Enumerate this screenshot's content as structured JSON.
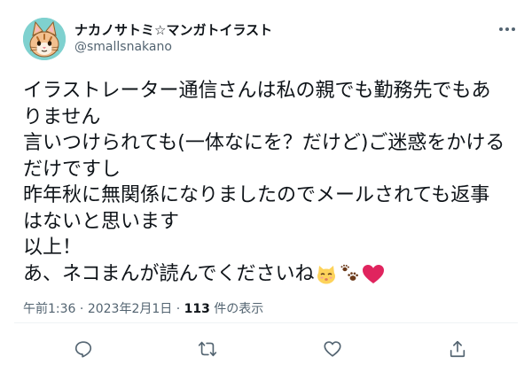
{
  "author": {
    "display_name": "ナカノサトミ☆マンガトイラスト",
    "handle": "@smallsnakano",
    "avatar_icon": "cat-avatar-icon"
  },
  "tweet": {
    "lines": [
      "イラストレーター通信さんは私の親でも勤務先でもあ",
      "りません",
      "言いつけられても(一体なにを？だけど)ご迷惑をかける",
      "だけですし",
      "昨年秋に無関係になりましたのでメールされても返事",
      "はないと思います",
      "以上！",
      "あ、ネコまんが読んでくださいね"
    ],
    "emojis": [
      "kissing-cat-emoji",
      "paw-prints-emoji",
      "red-heart-emoji"
    ]
  },
  "meta": {
    "time": "午前1:36",
    "separator": " · ",
    "date": "2023年2月1日",
    "views_count": "113",
    "views_label": " 件の表示"
  },
  "actions": [
    "reply-icon",
    "retweet-icon",
    "like-icon",
    "share-icon"
  ],
  "colors": {
    "text_primary": "#0f1419",
    "text_secondary": "#536471",
    "avatar_bg": "#7fd1cf",
    "heart": "#e0245e"
  }
}
